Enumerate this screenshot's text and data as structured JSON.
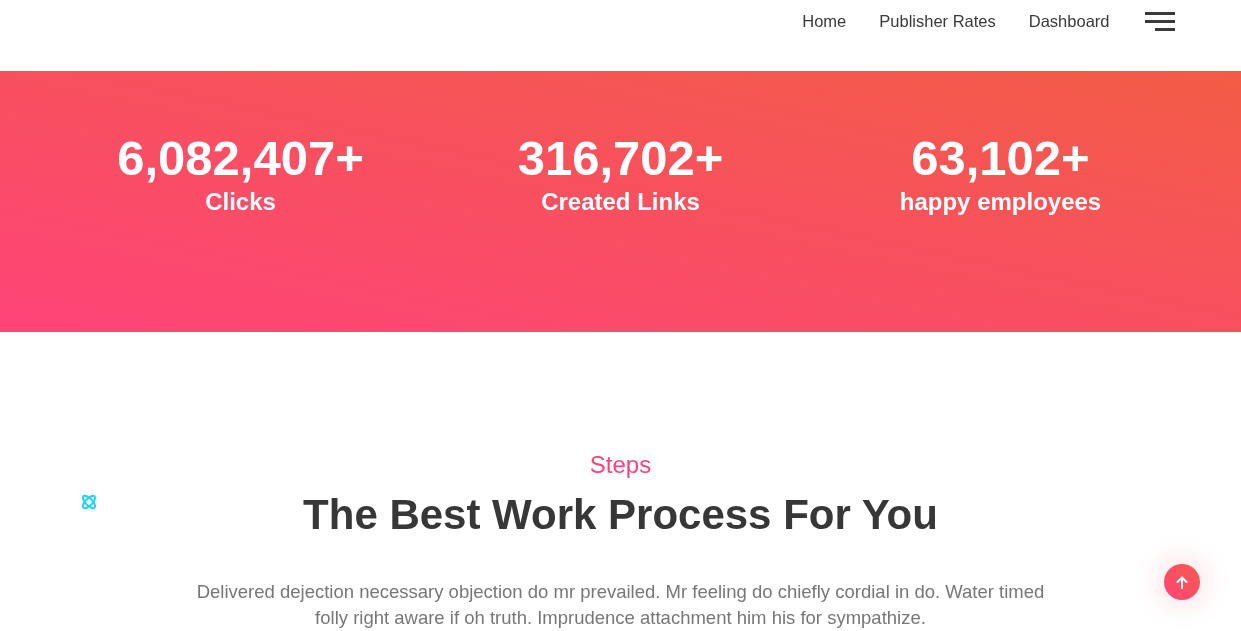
{
  "nav": {
    "links": [
      {
        "label": "Home"
      },
      {
        "label": "Publisher Rates"
      },
      {
        "label": "Dashboard"
      }
    ]
  },
  "stats": [
    {
      "value": "6,082,407+",
      "label": "Clicks"
    },
    {
      "value": "316,702+",
      "label": "Created Links"
    },
    {
      "value": "63,102+",
      "label": "happy employees"
    }
  ],
  "steps_section": {
    "eyebrow": "Steps",
    "title": "The Best Work Process For You",
    "description": "Delivered dejection necessary objection do mr prevailed. Mr feeling do chiefly cordial in do. Water timed folly right aware if oh truth. Imprudence attachment him his for sympathize."
  }
}
